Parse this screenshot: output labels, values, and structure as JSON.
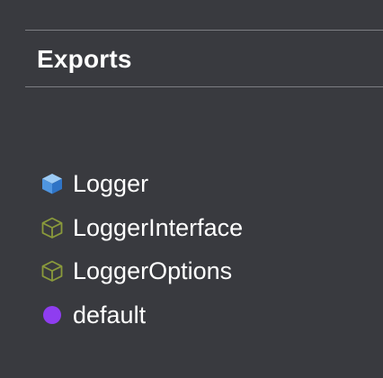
{
  "exports": {
    "title": "Exports",
    "items": [
      {
        "label": "Logger",
        "icon": "class-cube-icon",
        "icon_color": "#6aaeea"
      },
      {
        "label": "LoggerInterface",
        "icon": "interface-cube-outline-icon",
        "icon_color": "#8a9a3b"
      },
      {
        "label": "LoggerOptions",
        "icon": "interface-cube-outline-icon",
        "icon_color": "#8a9a3b"
      },
      {
        "label": "default",
        "icon": "variable-dot-icon",
        "icon_color": "#8f3df0"
      }
    ]
  }
}
